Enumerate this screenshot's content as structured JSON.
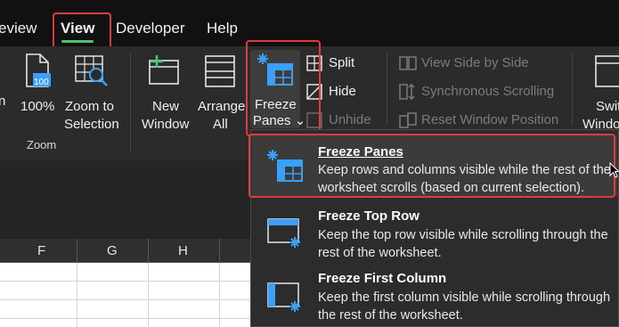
{
  "menu": {
    "tabs": [
      "eview",
      "View",
      "Developer",
      "Help"
    ]
  },
  "ribbon": {
    "zoom_label": "100%",
    "zoom_to_selection": [
      "Zoom to",
      "Selection"
    ],
    "zoom_group": "Zoom",
    "new_window": [
      "New",
      "Window"
    ],
    "arrange_all": [
      "Arrange",
      "All"
    ],
    "freeze_panes": [
      "Freeze",
      "Panes ⌄"
    ],
    "split": "Split",
    "hide": "Hide",
    "unhide": "Unhide",
    "view_side_by_side": "View Side by Side",
    "synchronous_scrolling": "Synchronous Scrolling",
    "reset_window_position": "Reset Window Position",
    "switch_windows": [
      "Swit",
      "Windo"
    ],
    "left_cut": "n",
    "zoom_badge": "100"
  },
  "columns": [
    "F",
    "G",
    "H"
  ],
  "dropdown": {
    "items": [
      {
        "title": "Freeze Panes",
        "desc": "Keep rows and columns visible while the rest of the worksheet scrolls (based on current selection)."
      },
      {
        "title": "Freeze Top Row",
        "desc": "Keep the top row visible while scrolling through the rest of the worksheet."
      },
      {
        "title": "Freeze First Column",
        "desc": "Keep the first column visible while scrolling through the rest of the worksheet."
      }
    ]
  },
  "colors": {
    "accent_green": "#4cc56b",
    "highlight_red": "#e03c3c",
    "icon_blue": "#3aa0ff"
  }
}
